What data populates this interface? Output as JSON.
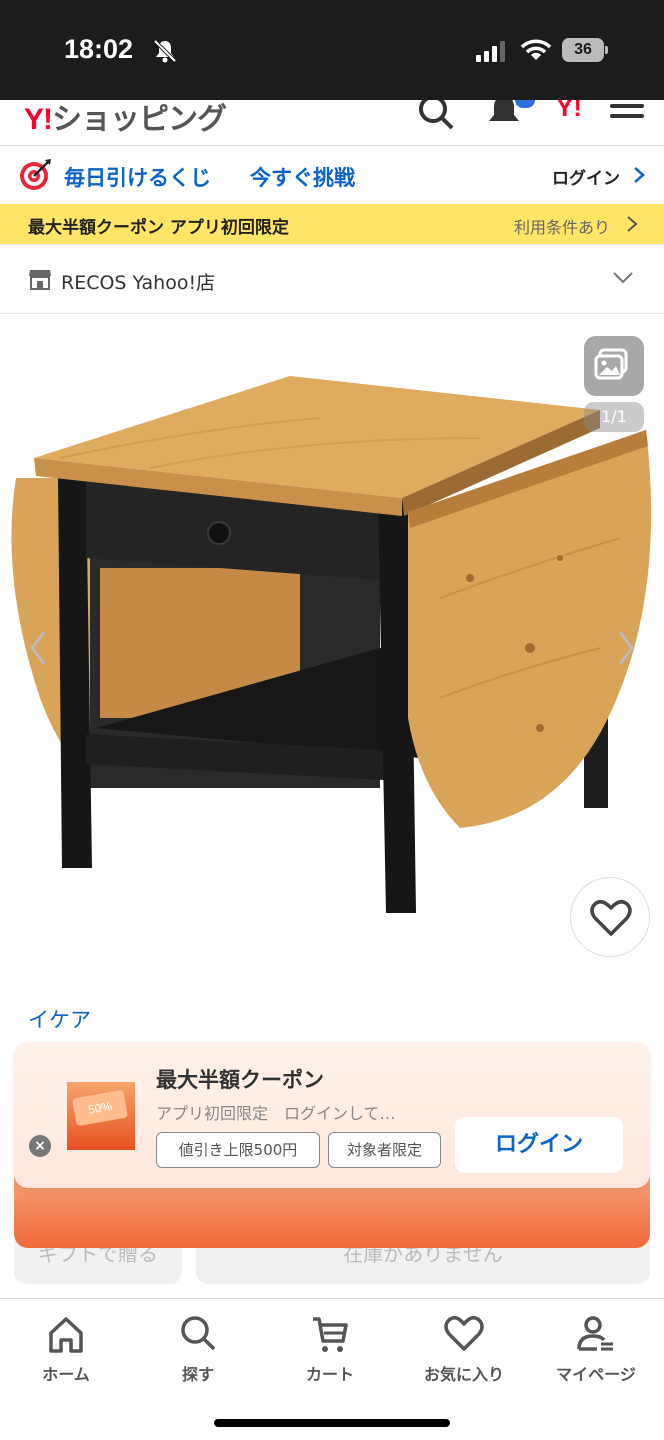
{
  "status_bar": {
    "time": "18:02",
    "battery": "36"
  },
  "header": {
    "logo_y": "Y!",
    "logo_text": "ショッピング",
    "mini_logo": "Y!"
  },
  "lottery": {
    "text": "毎日引けるくじ",
    "cta": "今すぐ挑戦",
    "login": "ログイン"
  },
  "coupon_strip": {
    "text": "最大半額クーポン アプリ初回限定",
    "terms": "利用条件あり"
  },
  "store": {
    "name": "RECOS Yahoo!店"
  },
  "gallery": {
    "counter": "1/1"
  },
  "product": {
    "brand": "イケア"
  },
  "ghost_buttons": {
    "left": "ギフトで贈る",
    "right": "在庫がありません"
  },
  "popup": {
    "thumb_text": "50%",
    "title": "最大半額クーポン",
    "subtitle": "アプリ初回限定　ログインして…",
    "tags": [
      "値引き上限500円",
      "対象者限定"
    ],
    "login": "ログイン",
    "close": "×"
  },
  "bottom_nav": {
    "items": [
      {
        "label": "ホーム",
        "icon": "home-icon"
      },
      {
        "label": "探す",
        "icon": "search-icon"
      },
      {
        "label": "カート",
        "icon": "cart-icon"
      },
      {
        "label": "お気に入り",
        "icon": "heart-icon"
      },
      {
        "label": "マイページ",
        "icon": "user-icon"
      }
    ]
  },
  "colors": {
    "accent_blue": "#0a63c8",
    "brand_red": "#ff0033",
    "coupon_yellow": "#ffe566",
    "promo_orange": "#f06a3c"
  }
}
